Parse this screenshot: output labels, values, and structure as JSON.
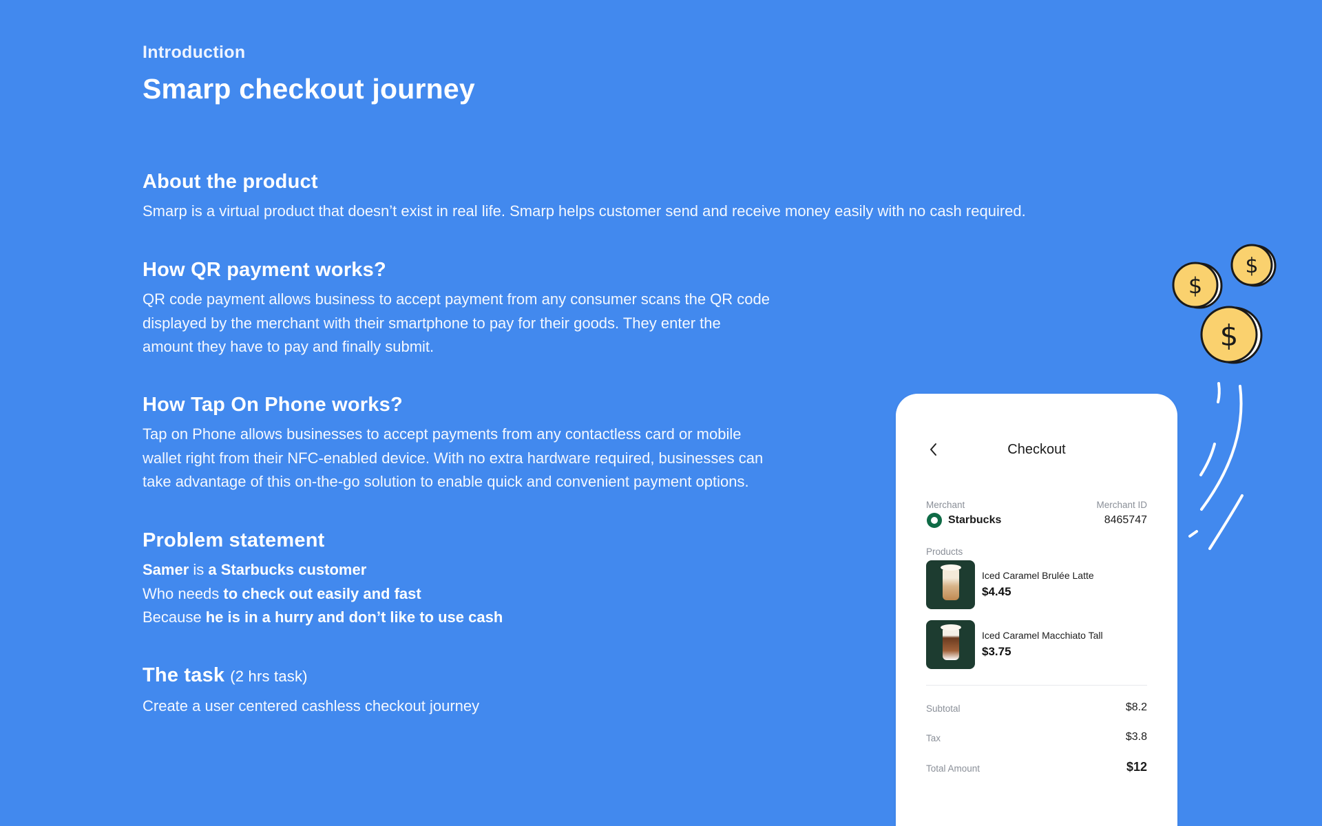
{
  "intro": {
    "overline": "Introduction",
    "title": "Smarp checkout journey"
  },
  "about": {
    "heading": "About the product",
    "body": "Smarp is a virtual product that doesn’t exist in real life. Smarp helps customer send and receive money easily with no cash required."
  },
  "qr": {
    "heading": "How QR payment works?",
    "lines": [
      "QR code payment allows business to accept payment from any consumer scans the QR code",
      "displayed by the merchant with their smartphone to pay for their goods. They enter the",
      "amount they have to pay and finally submit."
    ]
  },
  "tap": {
    "heading": "How Tap On Phone works?",
    "lines": [
      "Tap on Phone allows businesses to accept payments from any contactless card or mobile",
      "wallet right from their NFC-enabled device. With no extra hardware required, businesses can",
      "take advantage of this on-the-go solution to enable quick and convenient payment options."
    ]
  },
  "problem": {
    "heading": "Problem statement",
    "line1": {
      "b1": "Samer",
      "t1": " is ",
      "b2": "a Starbucks customer"
    },
    "line2": {
      "t1": "Who needs ",
      "b1": "to check out easily and fast"
    },
    "line3": {
      "t1": "Because ",
      "b1": "he is in a hurry and don’t like to use cash"
    }
  },
  "task": {
    "heading": "The task",
    "sub": "(2 hrs task)",
    "body": "Create a user centered cashless checkout journey"
  },
  "checkout": {
    "title": "Checkout",
    "back_icon": "chevron-left-icon",
    "merchant_label": "Merchant",
    "merchant_name": "Starbucks",
    "merchant_id_label": "Merchant ID",
    "merchant_id": "8465747",
    "products_label": "Products",
    "products": [
      {
        "name": "Iced Caramel Brulée Latte",
        "price": "$4.45"
      },
      {
        "name": "Iced Caramel Macchiato Tall",
        "price": "$3.75"
      }
    ],
    "subtotal_label": "Subtotal",
    "subtotal": "$8.2",
    "tax_label": "Tax",
    "tax": "$3.8",
    "total_label": "Total Amount",
    "total": "$12"
  },
  "colors": {
    "background": "#4289EE",
    "card": "#FFFFFF",
    "coin": "#FAD16E"
  }
}
